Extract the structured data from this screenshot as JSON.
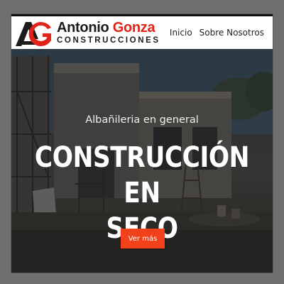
{
  "brand": {
    "name_part1": "Antonio ",
    "name_part2": "Gonza",
    "subtitle": "CONSTRUCCIONES",
    "logo_icon": "ag-logo-mark",
    "accent_color": "#e2231a"
  },
  "nav": {
    "items": [
      {
        "label": "Inicio"
      },
      {
        "label": "Sobre Nosotros"
      }
    ]
  },
  "hero": {
    "tagline": "Albañileria en general",
    "headline_line1": "CONSTRUCCIÓN EN",
    "headline_line2": "SECO",
    "cta_label": "Ver más",
    "cta_color": "#f2411b"
  }
}
